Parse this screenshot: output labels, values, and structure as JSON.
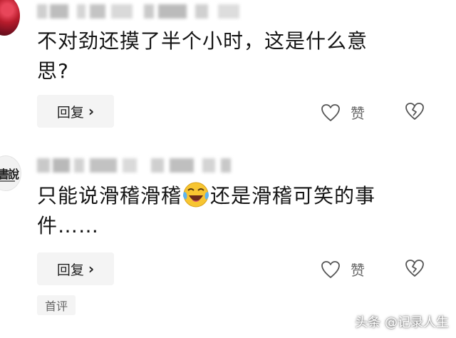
{
  "comments": [
    {
      "username": "",
      "text_line1": "不对劲还摸了半个小时，这是什么意",
      "text_line2": "思?",
      "reply_label": "回复",
      "like_label": "赞"
    },
    {
      "username": "",
      "text_before_emoji": "只能说滑稽滑稽",
      "text_after_emoji": "还是滑稽可笑的事",
      "text_line2": "件……",
      "reply_label": "回复",
      "like_label": "赞",
      "badge": "首评"
    }
  ],
  "watermark": "头条 @记录人生",
  "icons": {
    "like": "heart-outline-icon",
    "dislike": "broken-heart-icon",
    "chevron": "chevron-right-icon",
    "emoji": "laughing-crying-face-icon"
  }
}
